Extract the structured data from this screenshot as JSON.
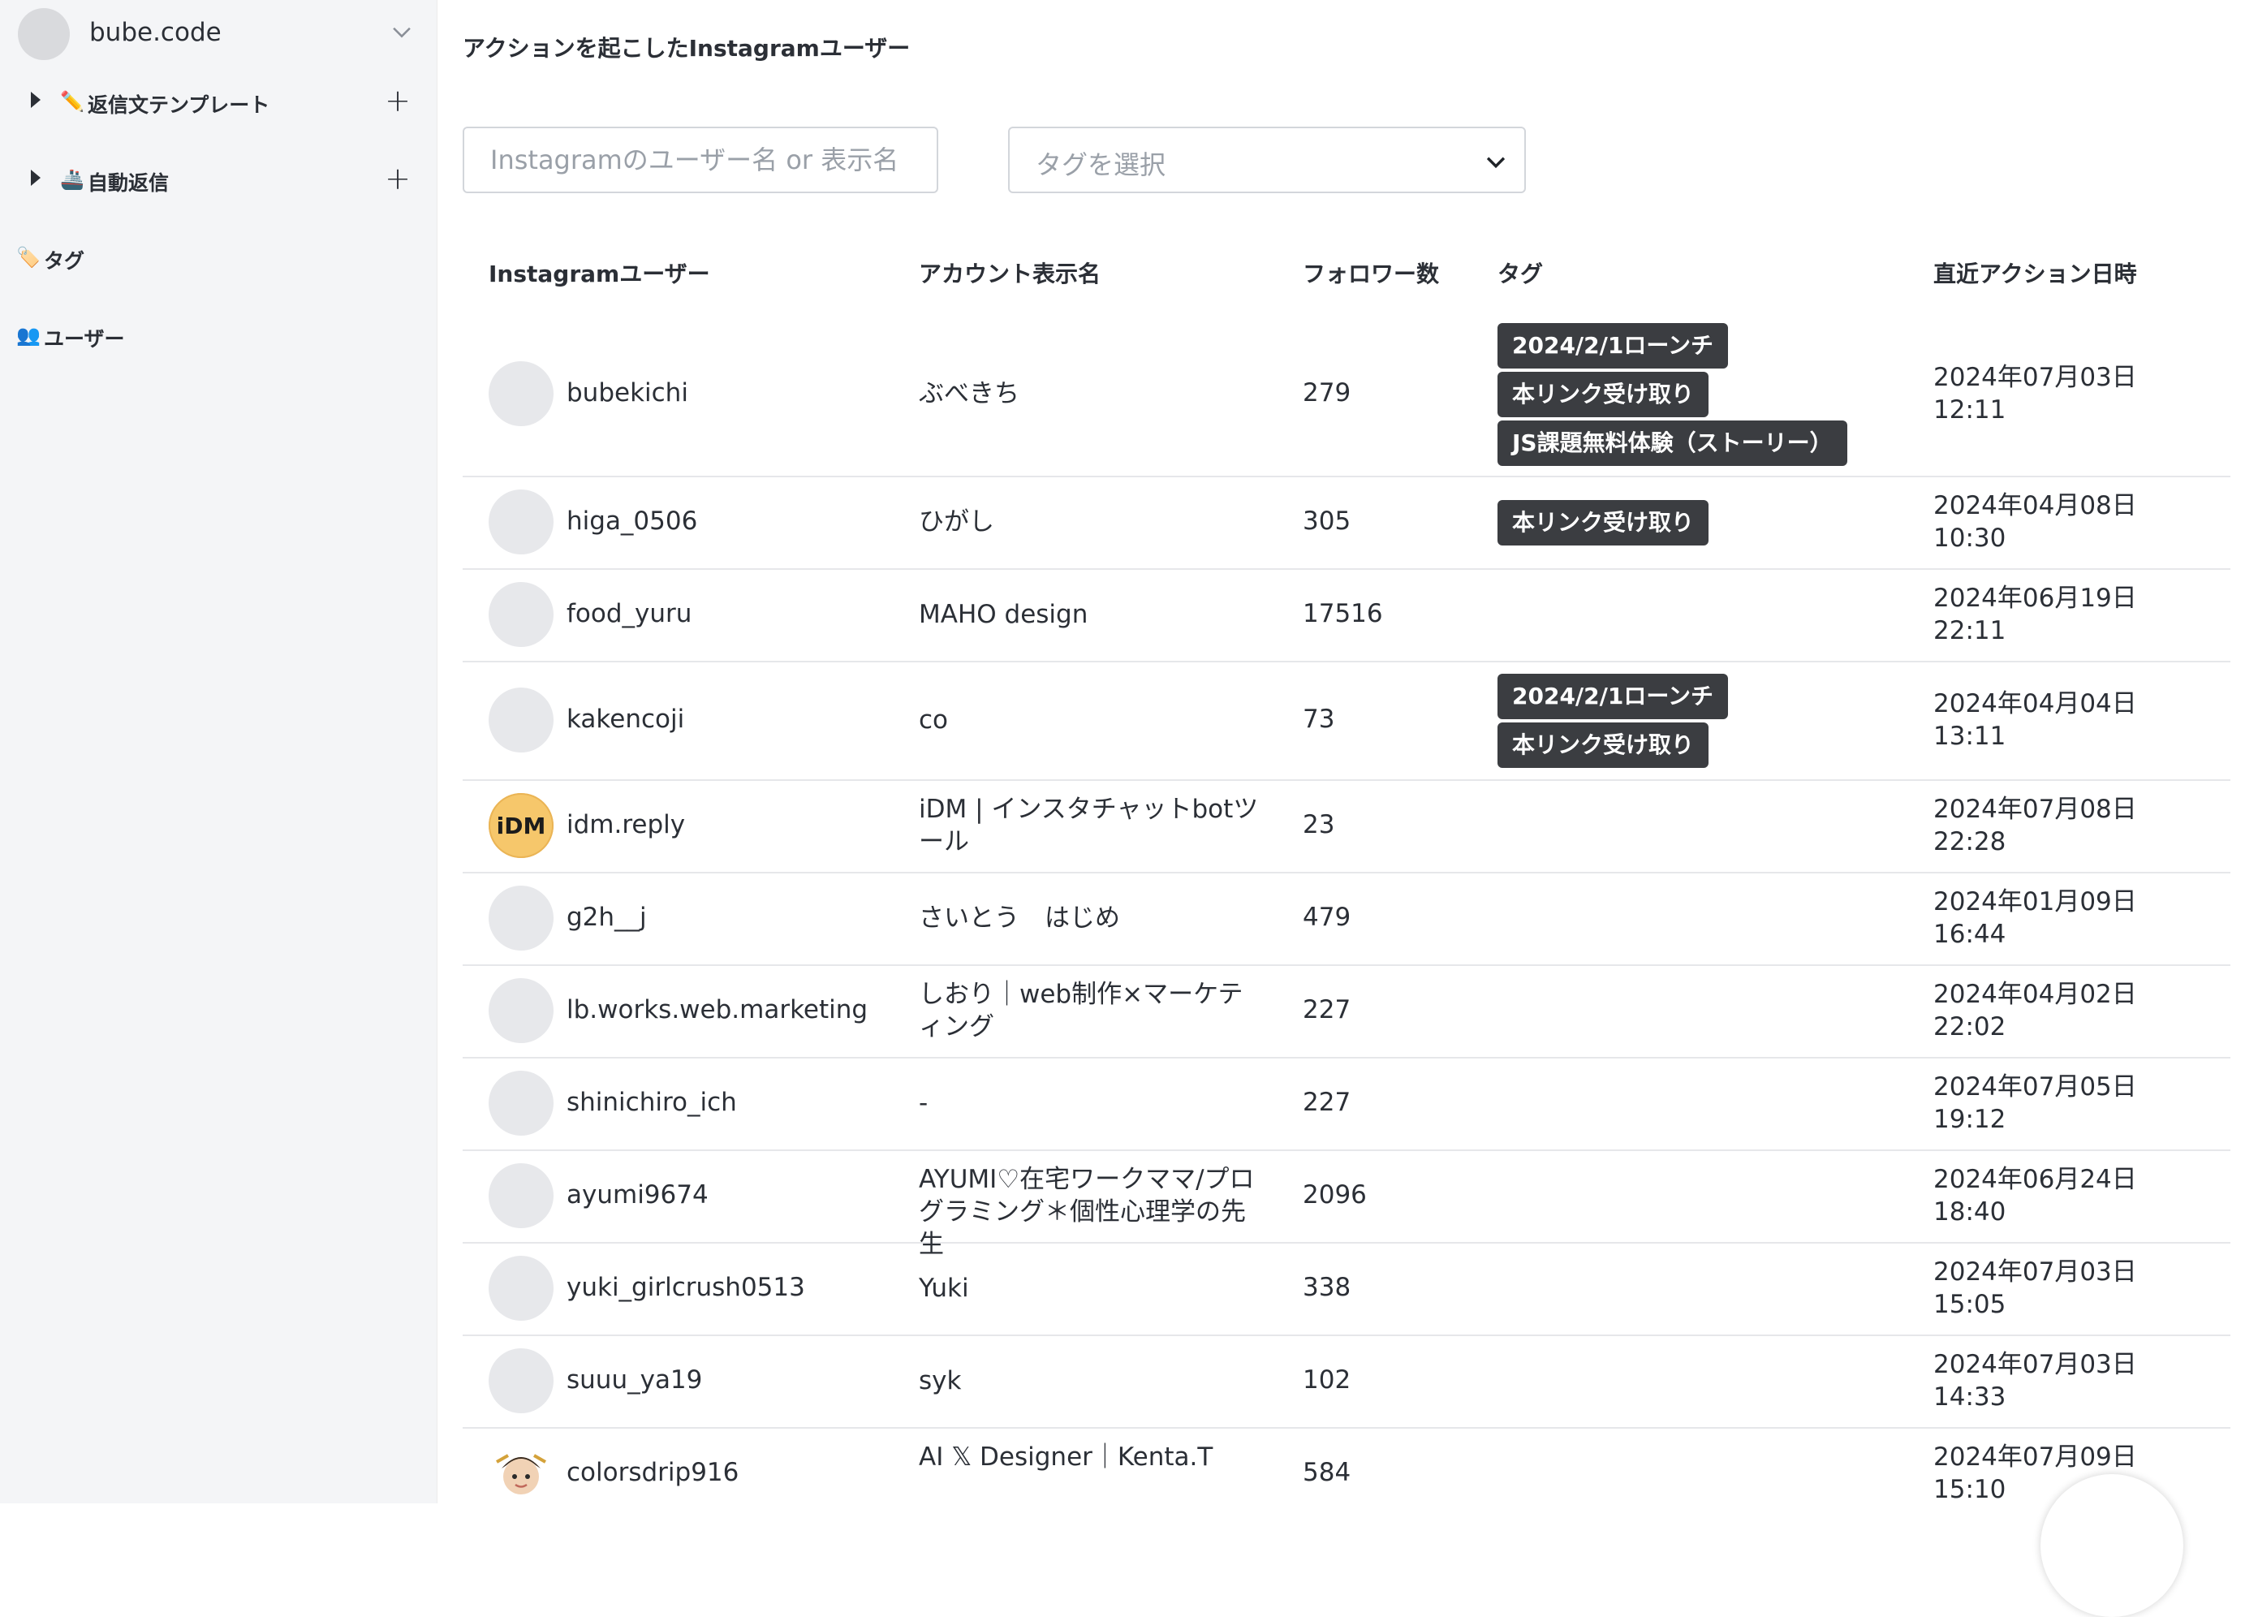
{
  "workspace": {
    "name": "bube.code"
  },
  "sidebar": {
    "items": [
      {
        "emoji": "✏️",
        "label": "返信文テンプレート",
        "plus": "+"
      },
      {
        "emoji": "🚢",
        "label": "自動返信",
        "plus": "+"
      },
      {
        "emoji": "🏷️",
        "label": "タグ"
      },
      {
        "emoji": "👥",
        "label": "ユーザー"
      }
    ]
  },
  "page": {
    "title": "アクションを起こしたInstagramユーザー"
  },
  "filters": {
    "search_placeholder": "Instagramのユーザー名 or 表示名",
    "tag_select_placeholder": "タグを選択"
  },
  "table": {
    "headers": {
      "user": "Instagramユーザー",
      "display_name": "アカウント表示名",
      "followers": "フォロワー数",
      "tags": "タグ",
      "last_action": "直近アクション日時"
    },
    "rows": [
      {
        "username": "bubekichi",
        "display": "ぶべきち",
        "followers": "279",
        "tags": [
          "2024/2/1ローンチ",
          "本リンク受け取り",
          "JS課題無料体験（ストーリー）"
        ],
        "date": "2024年07月03日",
        "time": "12:11",
        "avatar": "blank"
      },
      {
        "username": "higa_0506",
        "display": "ひがし",
        "followers": "305",
        "tags": [
          "本リンク受け取り"
        ],
        "date": "2024年04月08日",
        "time": "10:30",
        "avatar": "blank"
      },
      {
        "username": "food_yuru",
        "display": "MAHO design",
        "followers": "17516",
        "tags": [],
        "date": "2024年06月19日",
        "time": "22:11",
        "avatar": "blank"
      },
      {
        "username": "kakencoji",
        "display": "co",
        "followers": "73",
        "tags": [
          "2024/2/1ローンチ",
          "本リンク受け取り"
        ],
        "date": "2024年04月04日",
        "time": "13:11",
        "avatar": "blank"
      },
      {
        "username": "idm.reply",
        "display": "iDM | インスタチャットbotツール",
        "followers": "23",
        "tags": [],
        "date": "2024年07月08日",
        "time": "22:28",
        "avatar": "idm",
        "avatar_text": "iDM"
      },
      {
        "username": "g2h__j",
        "display": "さいとう　はじめ",
        "followers": "479",
        "tags": [],
        "date": "2024年01月09日",
        "time": "16:44",
        "avatar": "blank"
      },
      {
        "username": "lb.works.web.marketing",
        "display": "しおり｜web制作×マーケティング",
        "followers": "227",
        "tags": [],
        "date": "2024年04月02日",
        "time": "22:02",
        "avatar": "blank"
      },
      {
        "username": "shinichiro_ich",
        "display": "-",
        "followers": "227",
        "tags": [],
        "date": "2024年07月05日",
        "time": "19:12",
        "avatar": "blank"
      },
      {
        "username": "ayumi9674",
        "display": "AYUMI♡在宅ワークママ/プログラミング＊個性心理学の先生",
        "followers": "2096",
        "tags": [],
        "date": "2024年06月24日",
        "time": "18:40",
        "avatar": "blank"
      },
      {
        "username": "yuki_girlcrush0513",
        "display": "Yuki",
        "followers": "338",
        "tags": [],
        "date": "2024年07月03日",
        "time": "15:05",
        "avatar": "blank"
      },
      {
        "username": "suuu_ya19",
        "display": "syk",
        "followers": "102",
        "tags": [],
        "date": "2024年07月03日",
        "time": "14:33",
        "avatar": "blank"
      },
      {
        "username": "colorsdrip916",
        "display": "AI 𝕏 Designer｜Kenta.T",
        "followers": "584",
        "tags": [],
        "date": "2024年07月09日",
        "time": "15:10",
        "avatar": "face"
      }
    ]
  }
}
